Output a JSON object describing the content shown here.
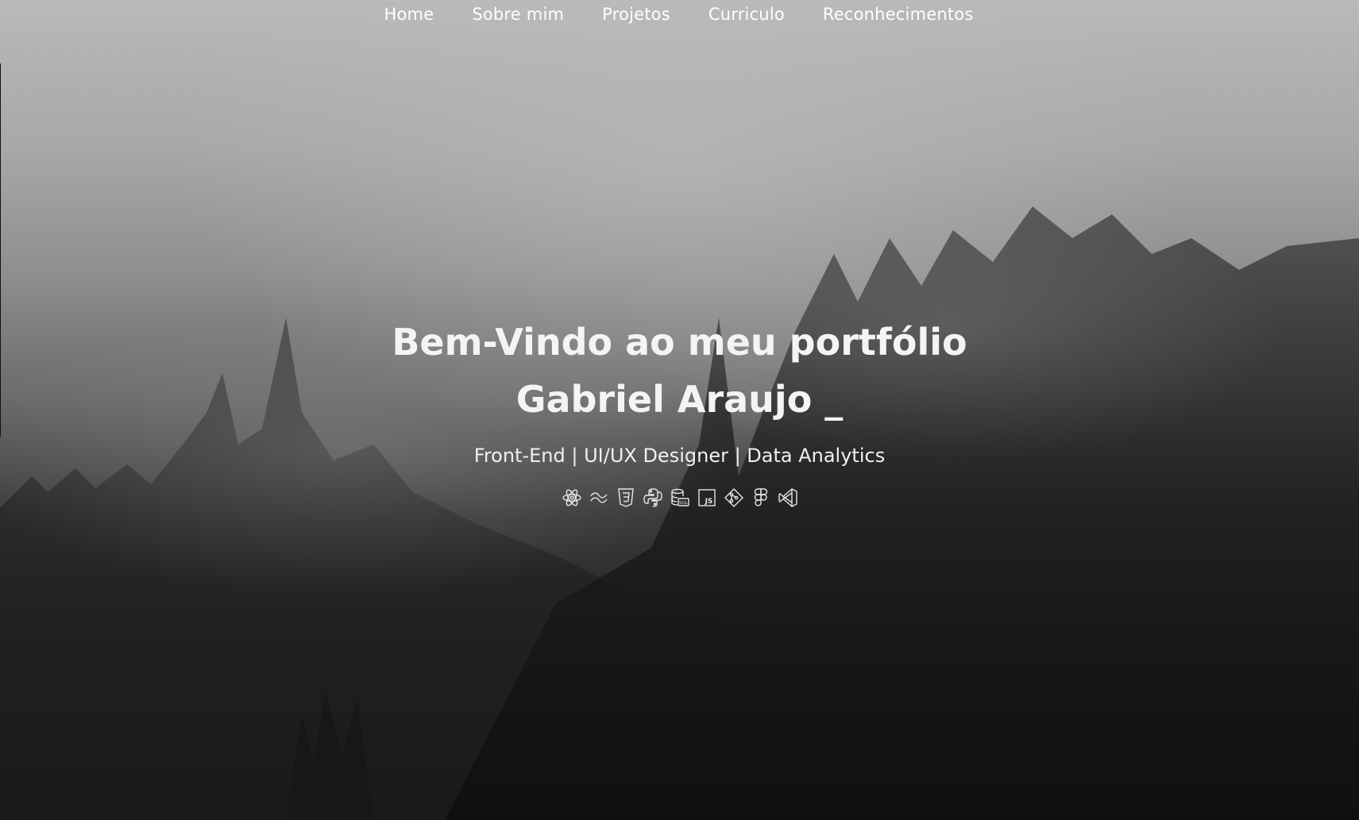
{
  "nav": {
    "items": [
      {
        "label": "Home"
      },
      {
        "label": "Sobre mim"
      },
      {
        "label": "Projetos"
      },
      {
        "label": "Curriculo"
      },
      {
        "label": "Reconhecimentos"
      }
    ]
  },
  "hero": {
    "title_line1": "Bem-Vindo ao meu portfólio",
    "title_line2": "Gabriel Araujo _",
    "subtitle": "Front-End | UI/UX Designer | Data Analytics",
    "skills": [
      {
        "icon": "react-icon"
      },
      {
        "icon": "tailwind-icon"
      },
      {
        "icon": "css3-icon"
      },
      {
        "icon": "python-icon"
      },
      {
        "icon": "sql-database-icon",
        "text": "SQL"
      },
      {
        "icon": "javascript-icon",
        "text": "JS"
      },
      {
        "icon": "git-icon"
      },
      {
        "icon": "figma-icon"
      },
      {
        "icon": "vscode-icon"
      }
    ]
  },
  "colors": {
    "text": "#ffffff",
    "background_top": "#b9b9b9",
    "background_bottom": "#141414"
  }
}
